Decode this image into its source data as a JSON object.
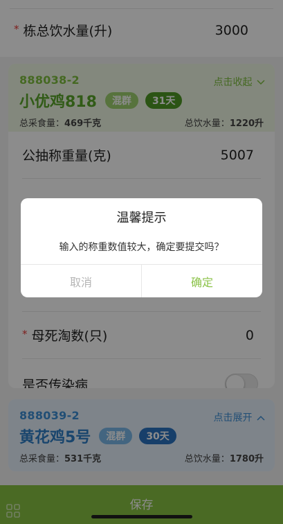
{
  "top": {
    "row_label": "栋总饮水量(升)",
    "row_value": "3000",
    "star": "*"
  },
  "group1": {
    "code": "888038-2",
    "toggle": "点击收起",
    "title": "小优鸡818",
    "badge_mix": "混群",
    "badge_days": "31天",
    "feed_label": "总采食量：",
    "feed_value": "469千克",
    "water_label": "总饮水量：",
    "water_value": "1220升",
    "rows": [
      {
        "label": "公抽称重量(克)",
        "value": "5007"
      },
      {
        "label": "母死淘数(只)",
        "value": "0",
        "star": "*"
      },
      {
        "label": "是否传染病"
      }
    ]
  },
  "group2": {
    "code": "888039-2",
    "toggle": "点击展开",
    "title": "黄花鸡5号",
    "badge_mix": "混群",
    "badge_days": "30天",
    "feed_label": "总采食量：",
    "feed_value": "531千克",
    "water_label": "总饮水量：",
    "water_value": "1780升"
  },
  "bottom": {
    "save_label": "保存"
  },
  "dialog": {
    "title": "温馨提示",
    "message": "输入的称重数值较大，确定要提交吗？",
    "cancel": "取消",
    "confirm": "确定"
  },
  "colors": {
    "green_accent": "#8cc34a",
    "blue_accent": "#3d8fd6",
    "required_star": "#e53935"
  },
  "icons": {
    "toggle_up": "chevron-up-icon",
    "toggle_down": "chevron-down-icon",
    "grid": "grid-icon"
  }
}
